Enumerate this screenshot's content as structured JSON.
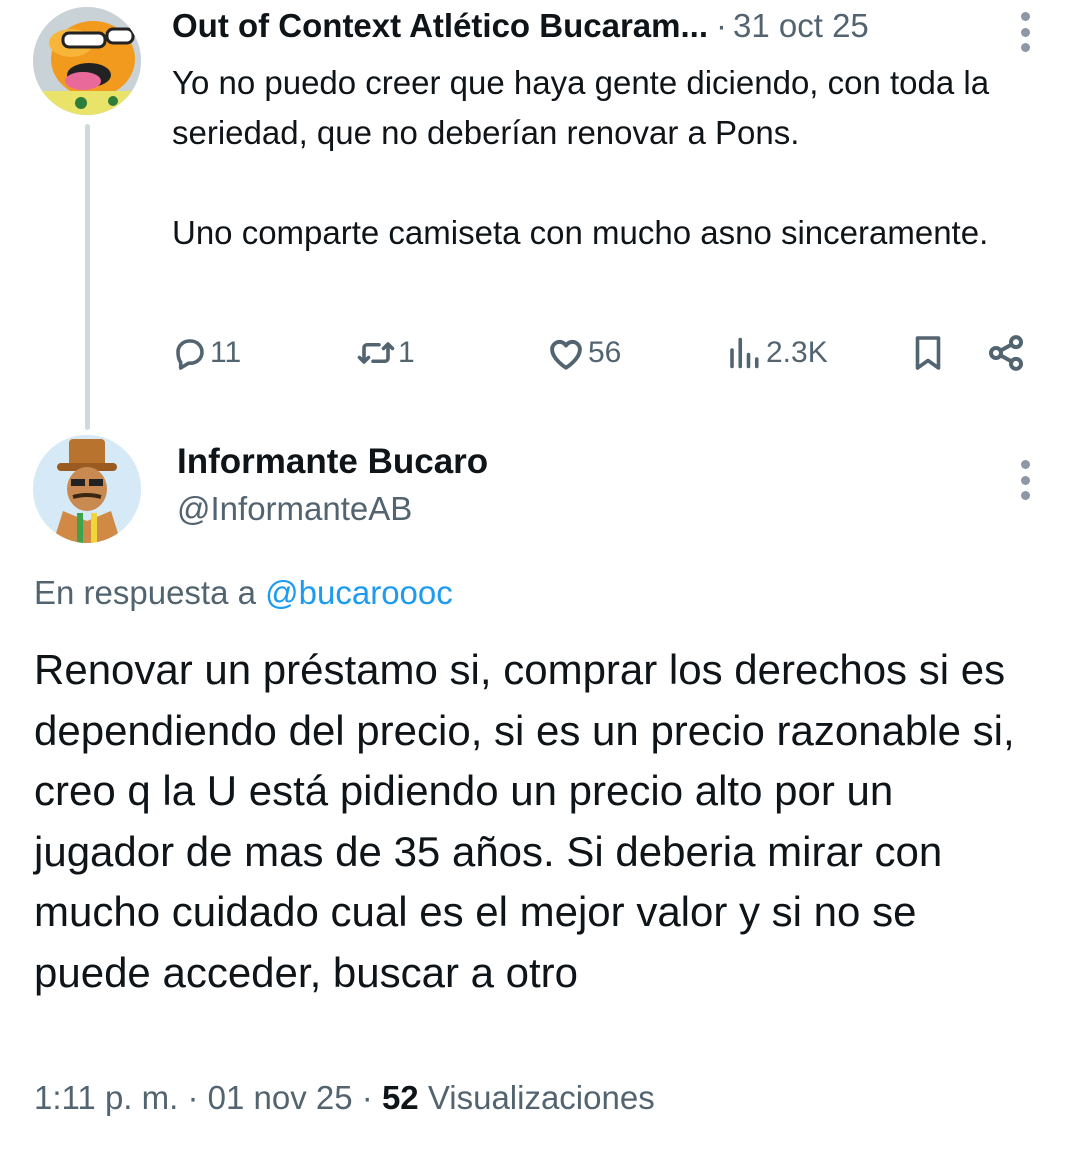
{
  "parent_tweet": {
    "author_name": "Out of Context Atlético Bucaram...",
    "separator": "·",
    "date": "31 oct 25",
    "text_paragraphs": [
      "Yo no puedo creer que haya gente diciendo, con toda la seriedad, que no deberían renovar a Pons.",
      "Uno comparte camiseta con mucho asno sinceramente."
    ],
    "actions": {
      "replies": "11",
      "retweets": "1",
      "likes": "56",
      "views": "2.3K"
    },
    "icons": [
      "reply-icon",
      "retweet-icon",
      "like-icon",
      "views-icon",
      "bookmark-icon",
      "share-icon",
      "more-icon"
    ]
  },
  "reply_tweet": {
    "author_name": "Informante Bucaro",
    "handle": "@InformanteAB",
    "reply_to_prefix": "En respuesta a",
    "reply_to_handle": "@bucaroooc",
    "text": "Renovar un préstamo si, comprar los derechos si es dependiendo del precio, si es un precio razonable si, creo q la U está pidiendo un precio alto por un jugador de mas de 35 años. Si deberia mirar con mucho cuidado cual es el mejor valor y si no se puede acceder, buscar a otro",
    "time": "1:11 p. m.",
    "separator": "·",
    "date": "01 nov 25",
    "views_count": "52",
    "views_label": "Visualizaciones"
  },
  "colors": {
    "text_primary": "#0f1419",
    "text_secondary": "#536471",
    "link": "#1d9bf0",
    "thread_line": "#cfd9de"
  }
}
